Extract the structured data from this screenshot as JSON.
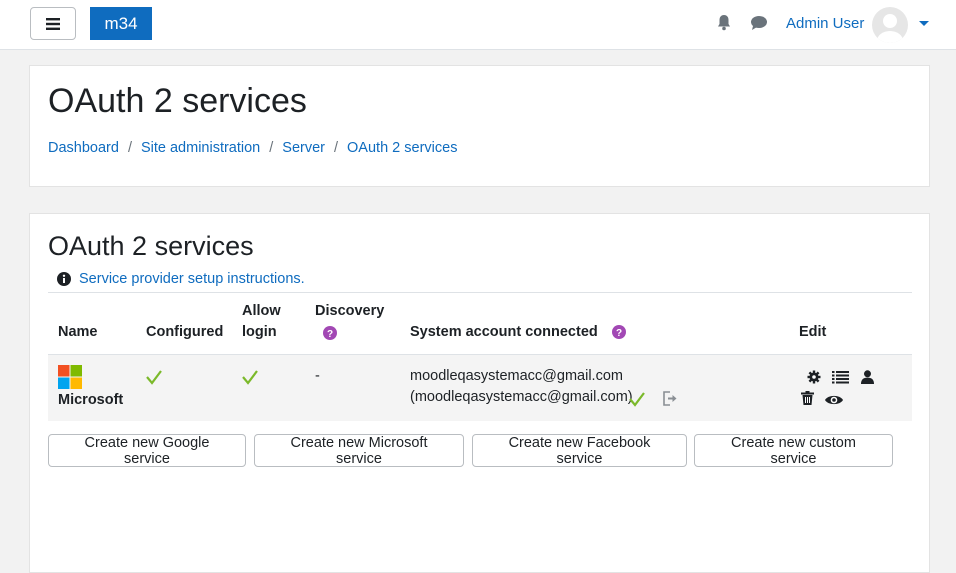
{
  "navbar": {
    "menu_icon": "hamburger-icon",
    "brand": "m34",
    "notifications_icon": "bell-icon",
    "messages_icon": "chat-icon",
    "user_name": "Admin User",
    "avatar_icon": "user-avatar"
  },
  "header": {
    "title": "OAuth 2 services",
    "breadcrumb": [
      "Dashboard",
      "Site administration",
      "Server",
      "OAuth 2 services"
    ],
    "separator": "/"
  },
  "main": {
    "title": "OAuth 2 services",
    "instructions_link": "Service provider setup instructions.",
    "columns": {
      "name": "Name",
      "configured": "Configured",
      "allow_login_1": "Allow",
      "allow_login_2": "login",
      "discovery": "Discovery",
      "system_account": "System account connected",
      "edit": "Edit"
    },
    "rows": [
      {
        "name": "Microsoft",
        "configured": true,
        "allow_login": true,
        "discovery": "-",
        "system_account_line1": "moodleqasystemacc@gmail.com",
        "system_account_line2": "(moodleqasystemacc@gmail.com)",
        "edit_icons": [
          "gear-icon",
          "list-icon",
          "user-icon",
          "trash-icon",
          "eye-icon"
        ]
      }
    ],
    "buttons": [
      "Create new Google service",
      "Create new Microsoft service",
      "Create new Facebook service",
      "Create new custom service"
    ]
  },
  "colors": {
    "primary": "#0f6cbf",
    "check": "#7bb92a",
    "help": "#a248b4"
  }
}
